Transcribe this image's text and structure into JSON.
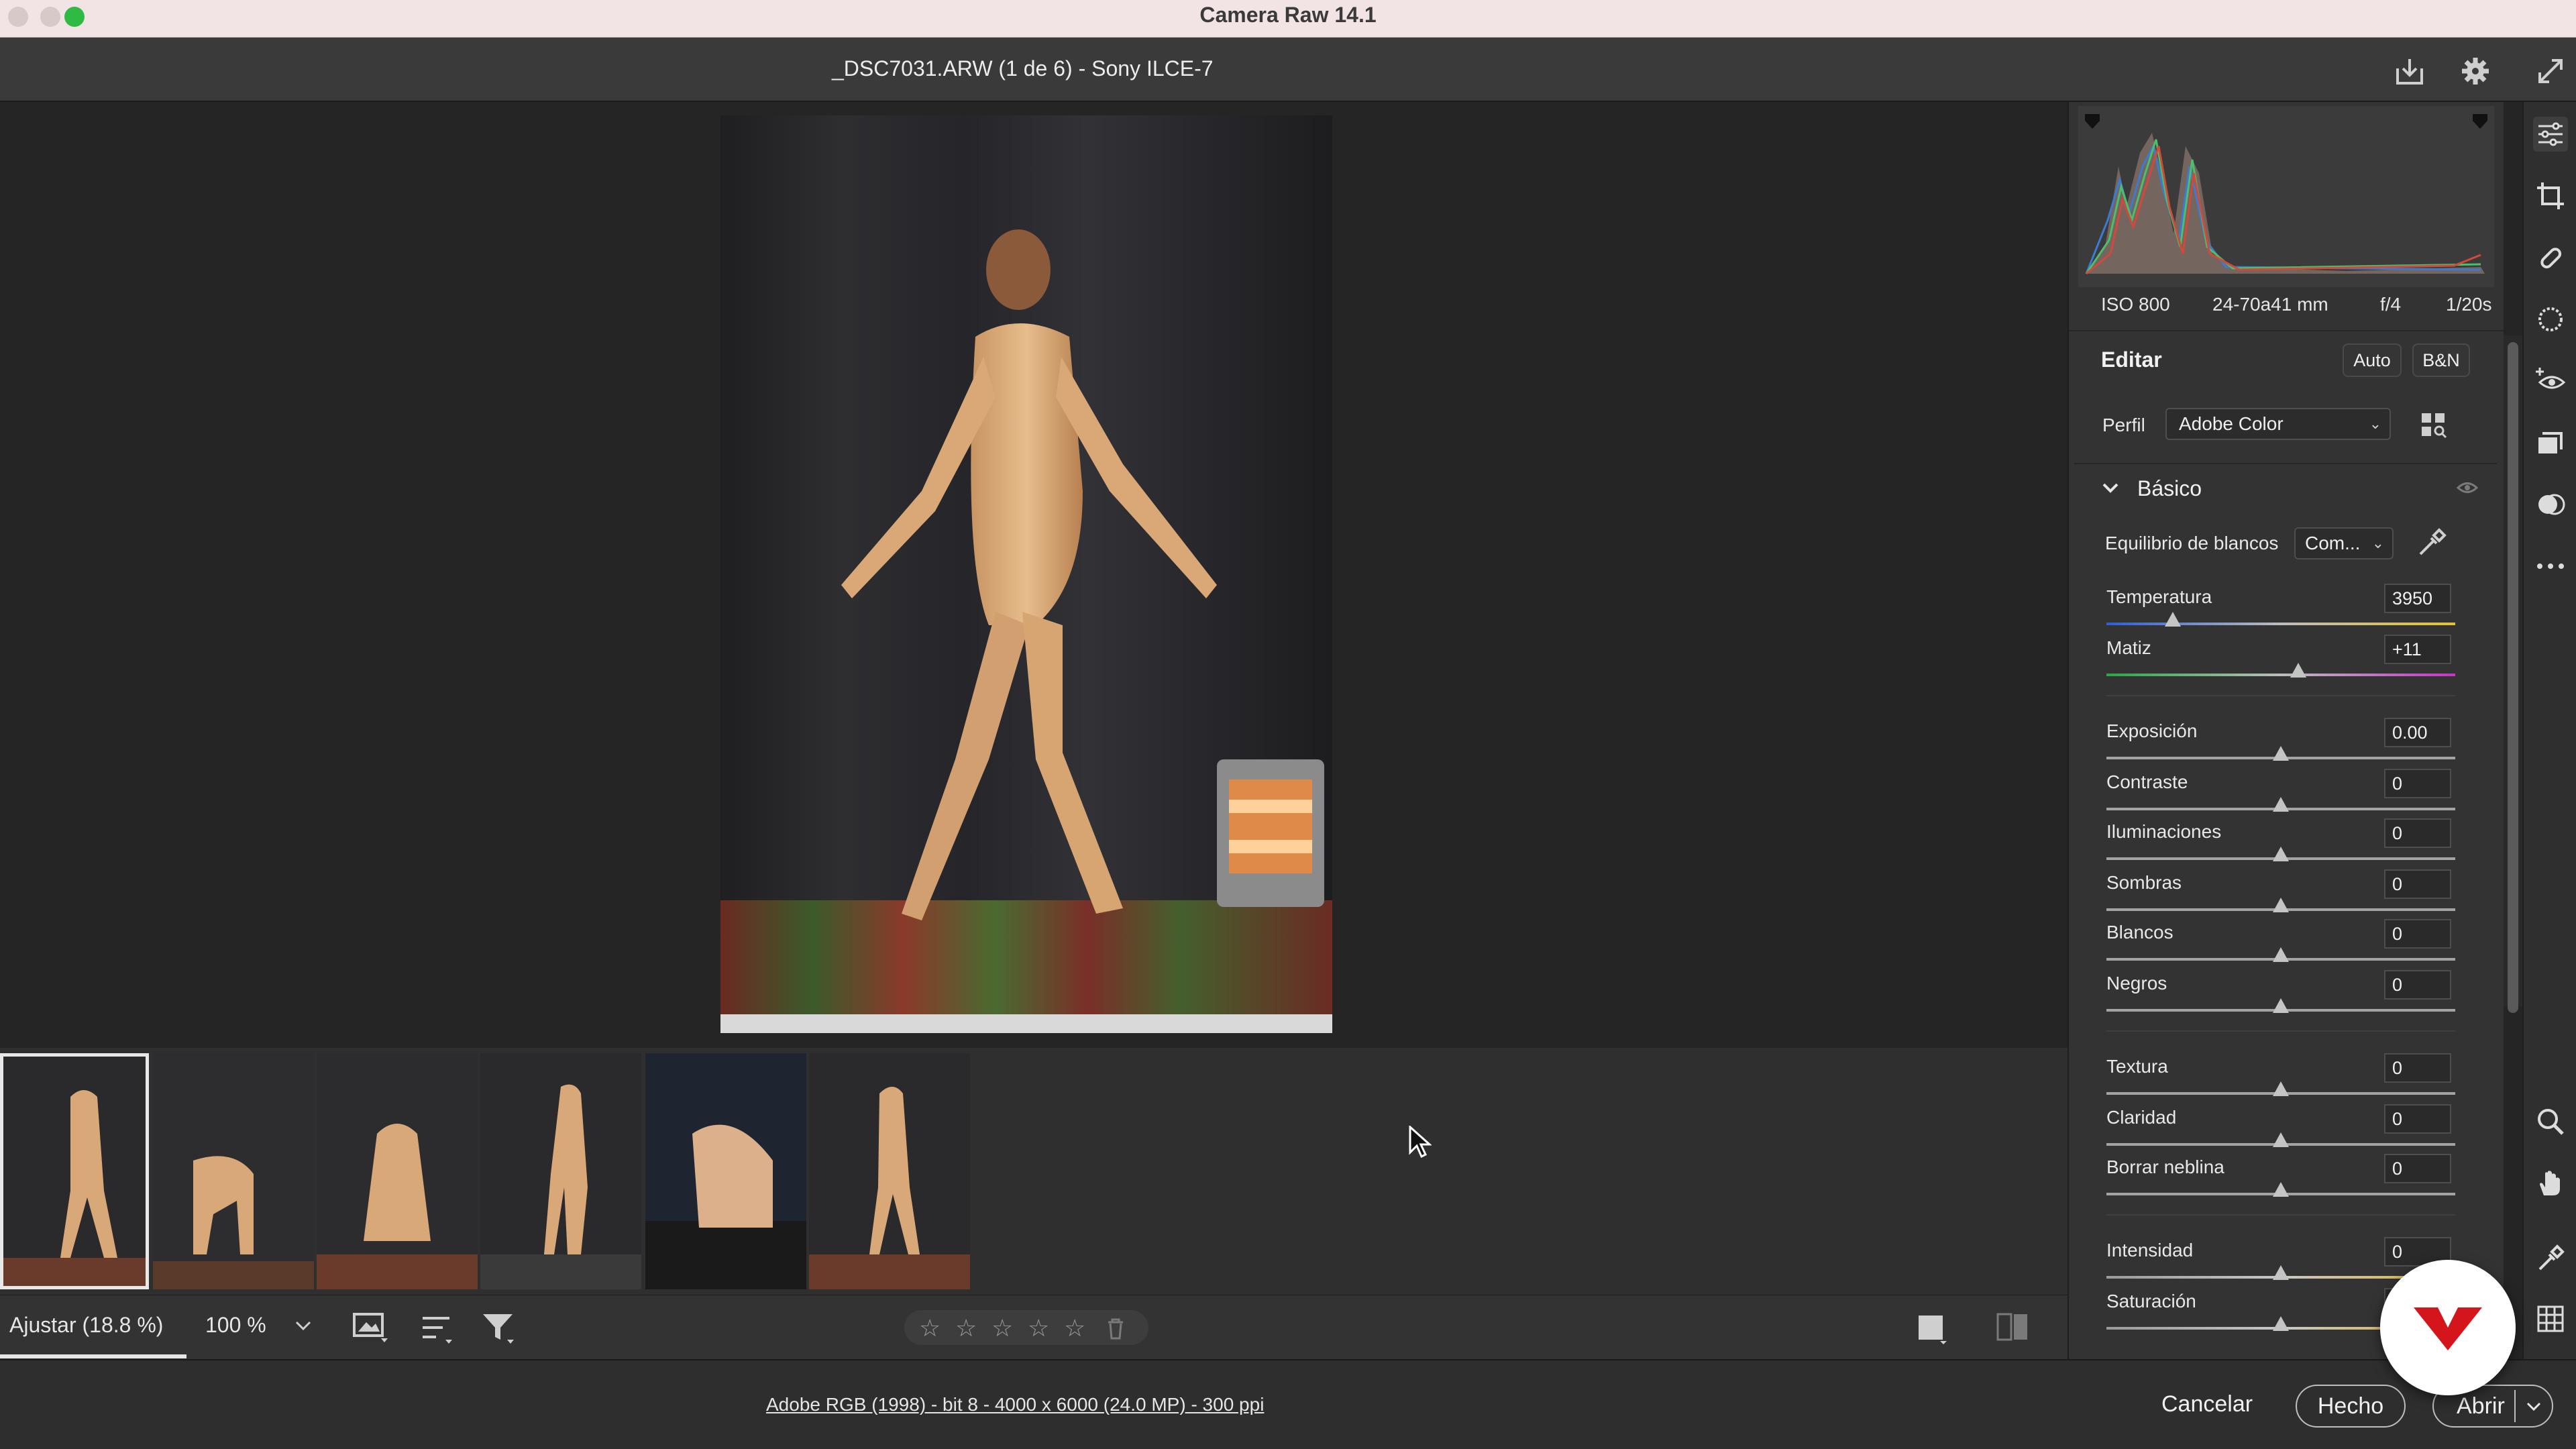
{
  "window": {
    "title": "Camera Raw 14.1",
    "traffic_colors": [
      "#d5c6c6",
      "#d5c6c6",
      "#2fba44"
    ]
  },
  "header": {
    "file_title": "_DSC7031.ARW (1 de 6) -  Sony ILCE-7",
    "icons": [
      "save-icon",
      "gear-icon",
      "fullscreen-icon"
    ]
  },
  "filmstrip": {
    "count": 6,
    "selected_index": 0
  },
  "toolbar": {
    "fit_label": "Ajustar (18.8 %)",
    "zoom_label": "100 %",
    "icons": [
      "slideshow-icon",
      "sort-icon",
      "filter-icon",
      "star-icon",
      "trash-icon",
      "single-view-icon",
      "compare-view-icon"
    ]
  },
  "exif": {
    "iso": "ISO 800",
    "lens": "24-70a41 mm",
    "aperture": "f/4",
    "shutter": "1/20s"
  },
  "edit": {
    "title": "Editar",
    "auto_label": "Auto",
    "bw_label": "B&N",
    "profile_label": "Perfil",
    "profile_value": "Adobe Color",
    "basic_title": "Básico",
    "wb_label": "Equilibrio de blancos",
    "wb_value": "Com...",
    "sliders": [
      {
        "name": "Temperatura",
        "value": "3950",
        "pos": 0.19
      },
      {
        "name": "Matiz",
        "value": "+11",
        "pos": 0.55
      },
      {
        "name": "Exposición",
        "value": "0.00",
        "pos": 0.5
      },
      {
        "name": "Contraste",
        "value": "0",
        "pos": 0.5
      },
      {
        "name": "Iluminaciones",
        "value": "0",
        "pos": 0.5
      },
      {
        "name": "Sombras",
        "value": "0",
        "pos": 0.5
      },
      {
        "name": "Blancos",
        "value": "0",
        "pos": 0.5
      },
      {
        "name": "Negros",
        "value": "0",
        "pos": 0.5
      },
      {
        "name": "Textura",
        "value": "0",
        "pos": 0.5
      },
      {
        "name": "Claridad",
        "value": "0",
        "pos": 0.5
      },
      {
        "name": "Borrar neblina",
        "value": "0",
        "pos": 0.5
      },
      {
        "name": "Intensidad",
        "value": "0",
        "pos": 0.5
      },
      {
        "name": "Saturación",
        "value": "0",
        "pos": 0.5
      }
    ]
  },
  "footer": {
    "info": "Adobe RGB (1998) - bit 8 - 4000 x 6000 (24.0 MP) - 300 ppi",
    "cancel_label": "Cancelar",
    "done_label": "Hecho",
    "open_label": "Abrir"
  },
  "rail_icons": [
    "edit-icon",
    "crop-icon",
    "heal-icon",
    "mask-icon",
    "redeye-icon",
    "presets-icon",
    "snapshots-icon",
    "more-icon",
    "zoom-icon",
    "hand-icon",
    "color-sampler-icon",
    "grid-icon"
  ]
}
